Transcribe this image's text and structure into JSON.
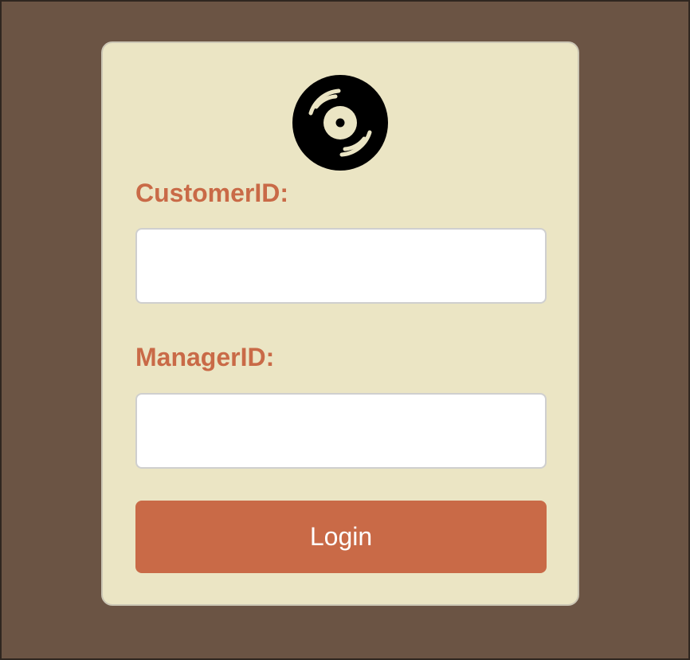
{
  "theme": {
    "page_background": "#6b5444",
    "card_background": "#ebe5c4",
    "label_color": "#c96a47",
    "button_color": "#c96a47",
    "button_text_color": "#ffffff"
  },
  "logo": {
    "icon": "vinyl-record-icon"
  },
  "form": {
    "customer_label": "CustomerID:",
    "customer_value": "",
    "manager_label": "ManagerID:",
    "manager_value": "",
    "login_label": "Login"
  }
}
